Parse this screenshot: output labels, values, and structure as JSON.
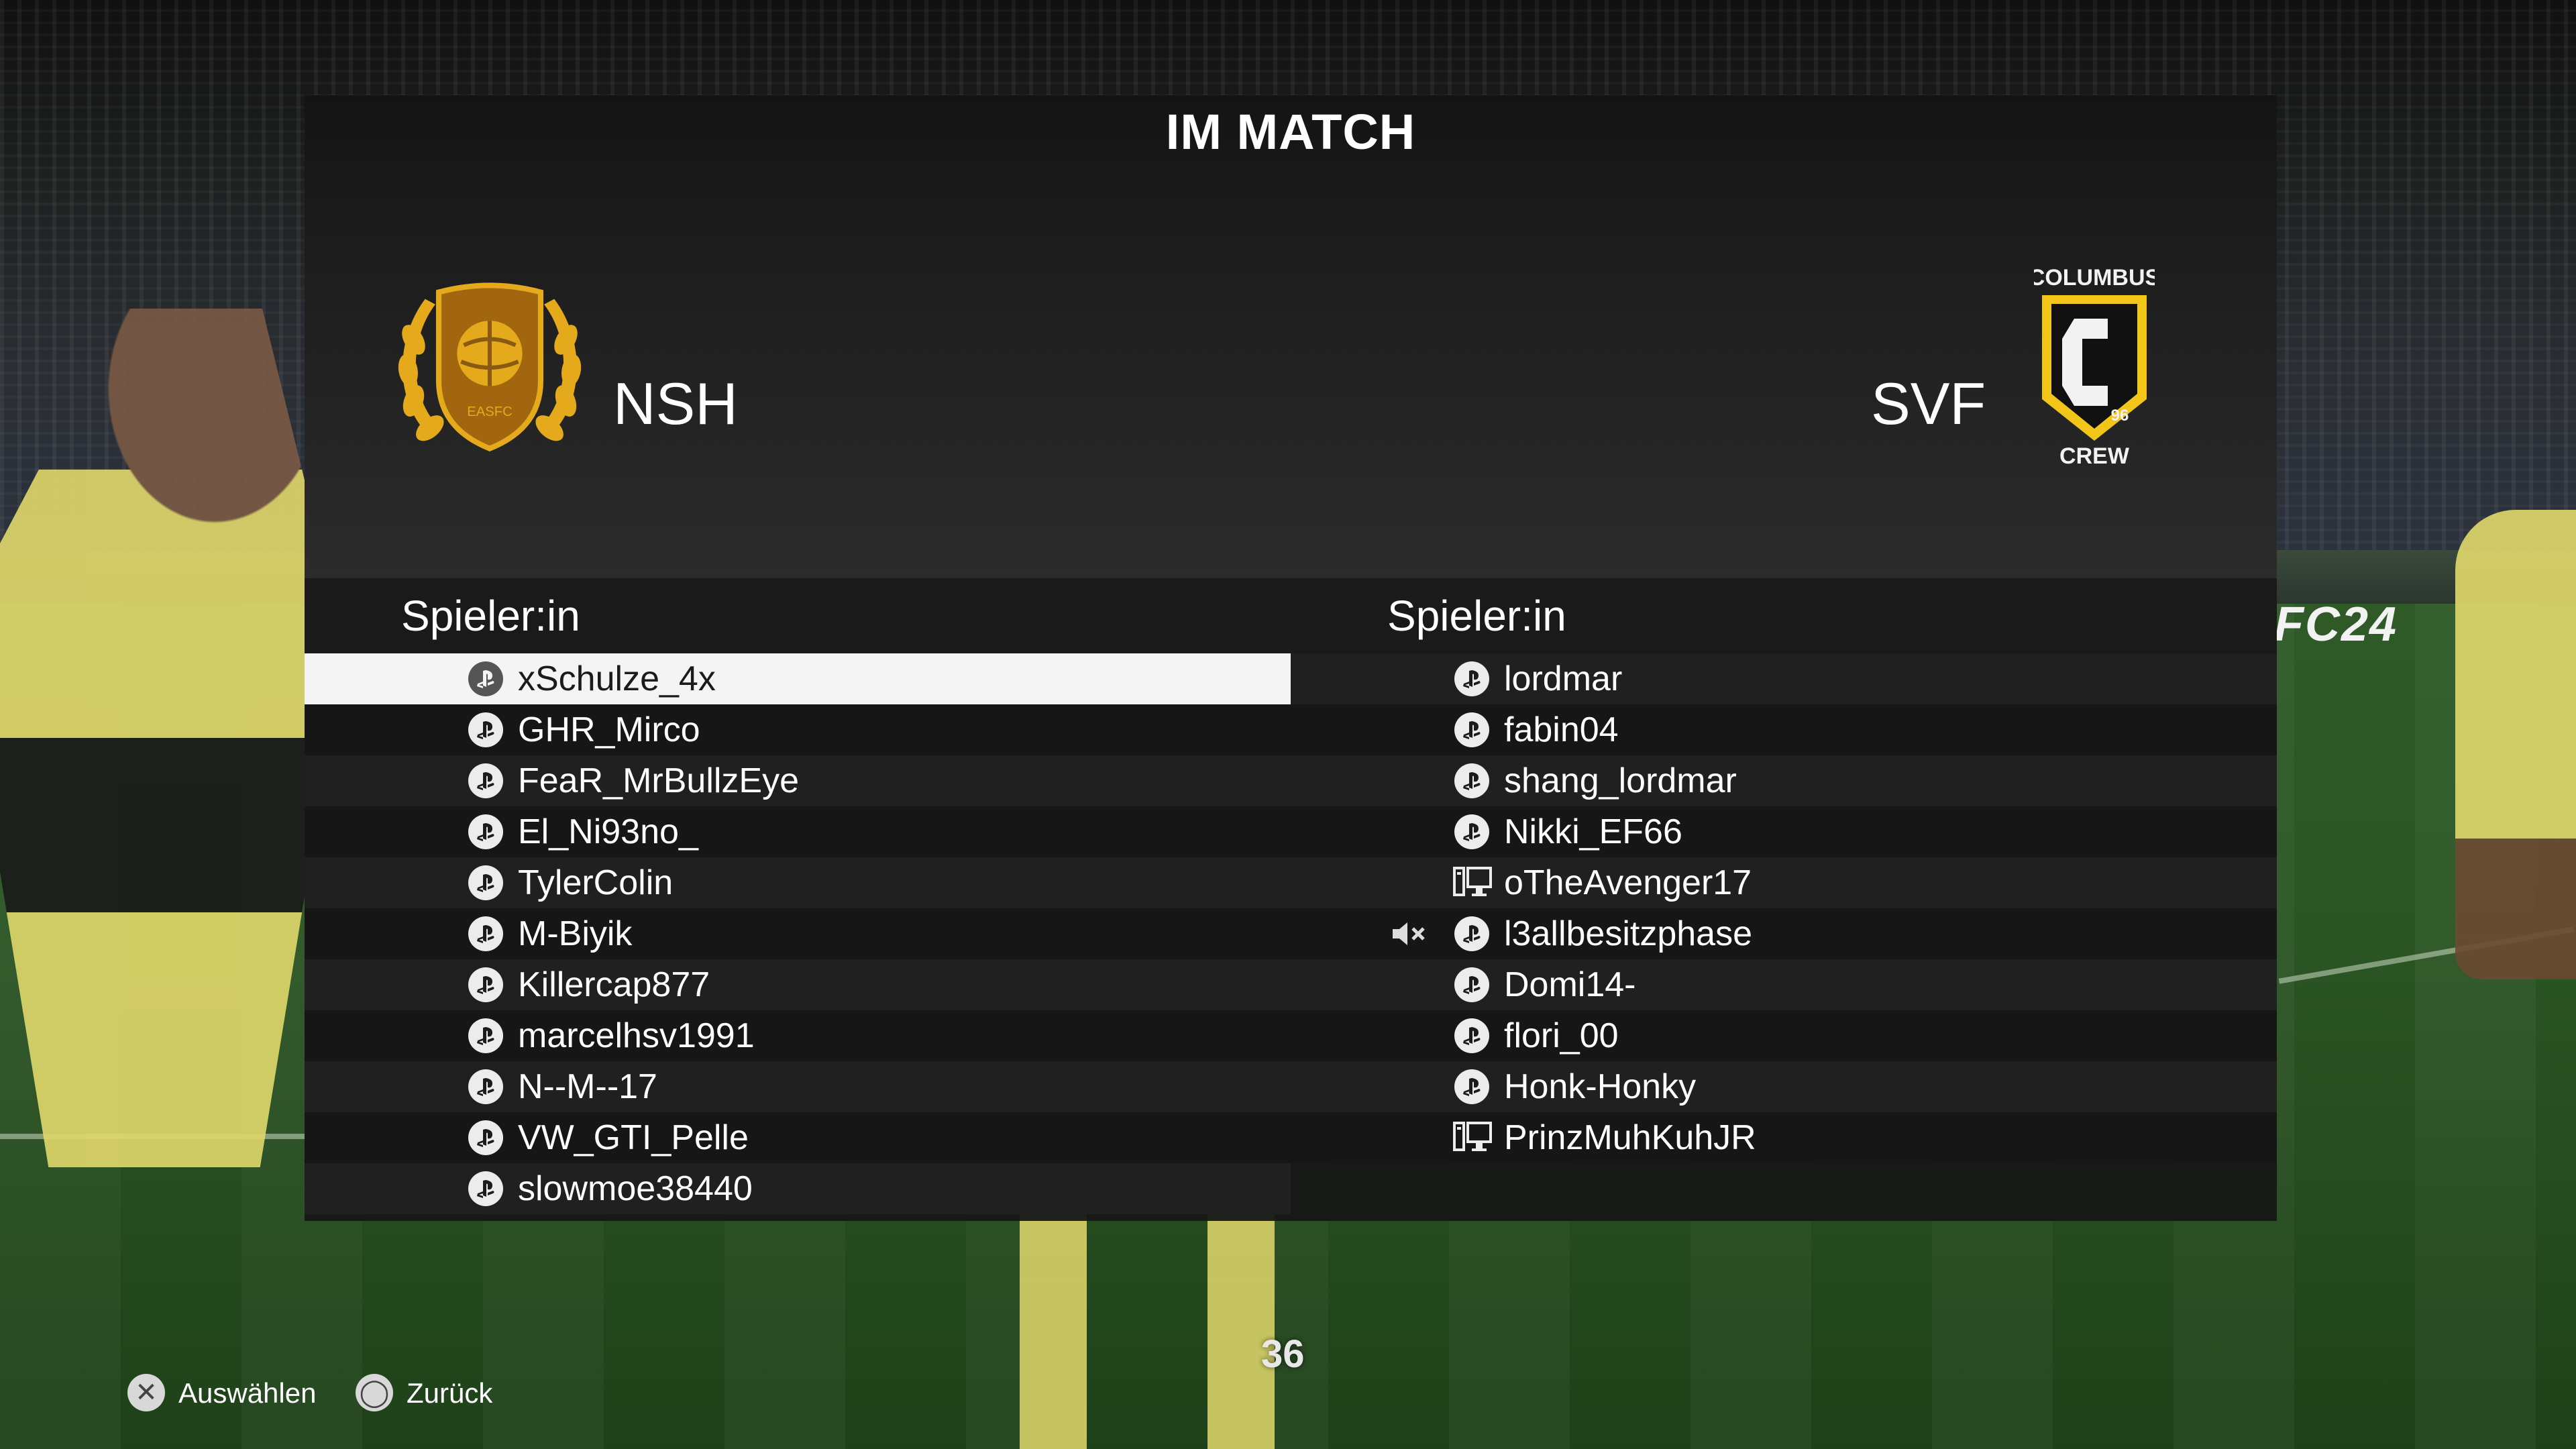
{
  "screen": {
    "title": "IM MATCH",
    "clock": "36",
    "fc_logo": "FC24"
  },
  "home": {
    "code": "NSH",
    "crest": "easfc-crest",
    "crest_text": "EASFC",
    "column_header": "Spieler:in",
    "players": [
      {
        "name": "xSchulze_4x",
        "platform": "playstation",
        "selected": true,
        "muted": false
      },
      {
        "name": "GHR_Mirco",
        "platform": "playstation",
        "selected": false,
        "muted": false
      },
      {
        "name": "FeaR_MrBullzEye",
        "platform": "playstation",
        "selected": false,
        "muted": false
      },
      {
        "name": "El_Ni93no_",
        "platform": "playstation",
        "selected": false,
        "muted": false
      },
      {
        "name": "TylerColin",
        "platform": "playstation",
        "selected": false,
        "muted": false
      },
      {
        "name": "M-Biyik",
        "platform": "playstation",
        "selected": false,
        "muted": false
      },
      {
        "name": "Killercap877",
        "platform": "playstation",
        "selected": false,
        "muted": false
      },
      {
        "name": "marcelhsv1991",
        "platform": "playstation",
        "selected": false,
        "muted": false
      },
      {
        "name": "N--M--17",
        "platform": "playstation",
        "selected": false,
        "muted": false
      },
      {
        "name": "VW_GTI_Pelle",
        "platform": "playstation",
        "selected": false,
        "muted": false
      },
      {
        "name": "slowmoe38440",
        "platform": "playstation",
        "selected": false,
        "muted": false
      }
    ]
  },
  "away": {
    "code": "SVF",
    "crest": "columbus-crew-crest",
    "crest_top": "COLUMBUS",
    "crest_bottom": "CREW",
    "crest_number": "96",
    "column_header": "Spieler:in",
    "players": [
      {
        "name": "lordmar",
        "platform": "playstation",
        "muted": false
      },
      {
        "name": "fabin04",
        "platform": "playstation",
        "muted": false
      },
      {
        "name": "shang_lordmar",
        "platform": "playstation",
        "muted": false
      },
      {
        "name": "Nikki_EF66",
        "platform": "playstation",
        "muted": false
      },
      {
        "name": "oTheAvenger17",
        "platform": "pc",
        "muted": false
      },
      {
        "name": "l3allbesitzphase",
        "platform": "playstation",
        "muted": true
      },
      {
        "name": "Domi14-",
        "platform": "playstation",
        "muted": false
      },
      {
        "name": "flori_00",
        "platform": "playstation",
        "muted": false
      },
      {
        "name": "Honk-Honky",
        "platform": "playstation",
        "muted": false
      },
      {
        "name": "PrinzMuhKuhJR",
        "platform": "pc",
        "muted": false
      }
    ]
  },
  "footer": {
    "select_label": "Auswählen",
    "select_button": "cross-button",
    "back_label": "Zurück",
    "back_button": "circle-button"
  },
  "colors": {
    "crest_gold": "#e5a91c",
    "crest_dark": "#8a5a12",
    "crew_yellow": "#f1c619",
    "panel_bg": "#161616",
    "selected_row": "#f4f4f4"
  }
}
